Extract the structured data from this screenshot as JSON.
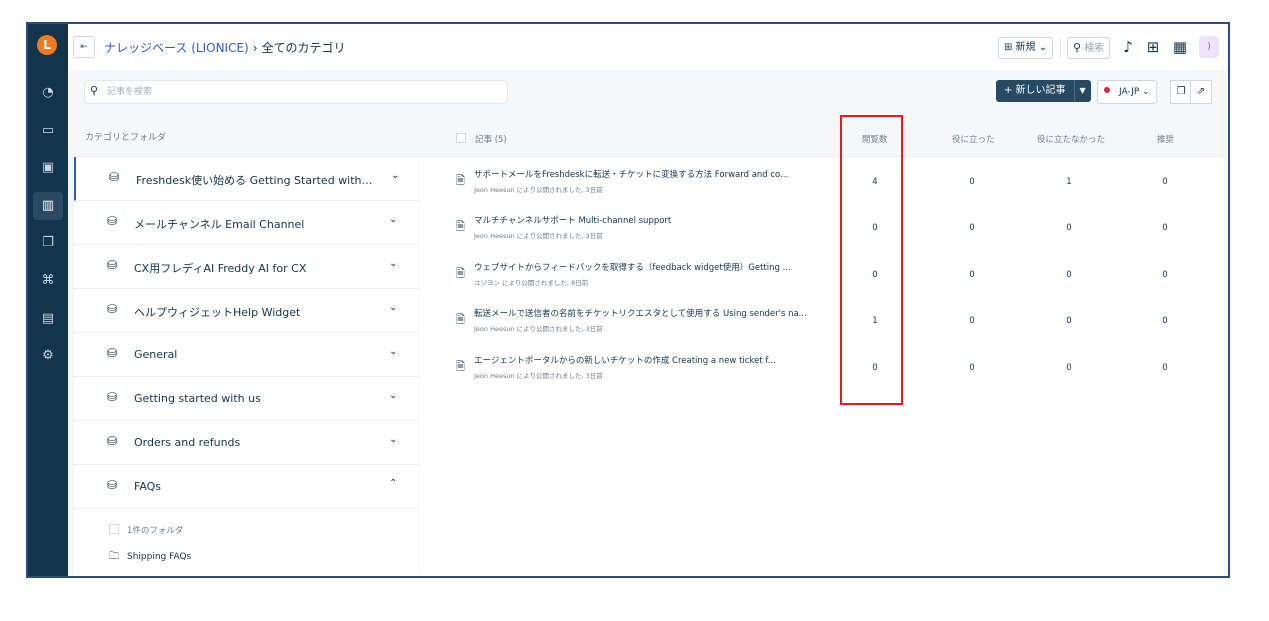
{
  "app": {
    "logo_letter": "L"
  },
  "breadcrumb": {
    "root": "ナレッジベース (LIONICE)",
    "separator": "›",
    "current": "全てのカテゴリ"
  },
  "topbar": {
    "new_label": "⊞ 新規 ⌄",
    "search_label": "検索"
  },
  "search": {
    "placeholder": "記事を検索"
  },
  "toolbar": {
    "new_article_label": "+ 新しい記事",
    "language": "JA-JP ⌄"
  },
  "categories": {
    "header": "カテゴリとフォルダ",
    "items": [
      {
        "name": "Freshdesk使い始める Getting Started with Fresh...",
        "chevron": "⌄"
      },
      {
        "name": "メールチャンネル Email Channel",
        "chevron": "⌄"
      },
      {
        "name": "CX用フレディAI Freddy AI for CX",
        "chevron": "⌄"
      },
      {
        "name": "ヘルプウィジェットHelp Widget",
        "chevron": "⌄"
      },
      {
        "name": "General",
        "chevron": "⌄"
      },
      {
        "name": "Getting started with us",
        "chevron": "⌄"
      },
      {
        "name": "Orders and refunds",
        "chevron": "⌄"
      },
      {
        "name": "FAQs",
        "chevron": "⌃"
      }
    ],
    "expanded": {
      "folder_count": "1件のフォルダ",
      "folders": [
        "Shipping FAQs"
      ]
    }
  },
  "articles": {
    "columns": {
      "title": "記事 (5)",
      "views": "閲覧数",
      "helpful": "役に立った",
      "not_helpful": "役に立たなかった",
      "recommended": "推奨"
    },
    "rows": [
      {
        "title": "サポートメールをFreshdeskに転送・チケットに変換する方法 Forward and co...",
        "meta": "Jeon Heesun により公開されました, 3日前",
        "views": "4",
        "helpful": "0",
        "not_helpful": "1",
        "recommended": "0"
      },
      {
        "title": "マルチチャンネルサポート Multi-channel support",
        "meta": "Jeon Heesun により公開されました, 3日前",
        "views": "0",
        "helpful": "0",
        "not_helpful": "0",
        "recommended": "0"
      },
      {
        "title": "ウェブサイトからフィードバックを取得する（feedback widget使用）Getting ...",
        "meta": "ユジヨン により公開されました, 8日前",
        "views": "0",
        "helpful": "0",
        "not_helpful": "0",
        "recommended": "0"
      },
      {
        "title": "転送メールで送信者の名前をチケットリクエスタとして使用する Using sender's na...",
        "meta": "Jeon Heesun により公開されました, 3日前",
        "views": "1",
        "helpful": "0",
        "not_helpful": "0",
        "recommended": "0"
      },
      {
        "title": "エージェントポータルからの新しいチケットの作成 Creating a new ticket f...",
        "meta": "Jeon Heesun により公開されました, 3日前",
        "views": "0",
        "helpful": "0",
        "not_helpful": "0",
        "recommended": "0"
      }
    ]
  },
  "colors": {
    "rail": "#12344d",
    "link": "#2c5cc5",
    "primary_button": "#264966",
    "highlight_box": "#e01e1e",
    "logo": "#f07b22"
  }
}
